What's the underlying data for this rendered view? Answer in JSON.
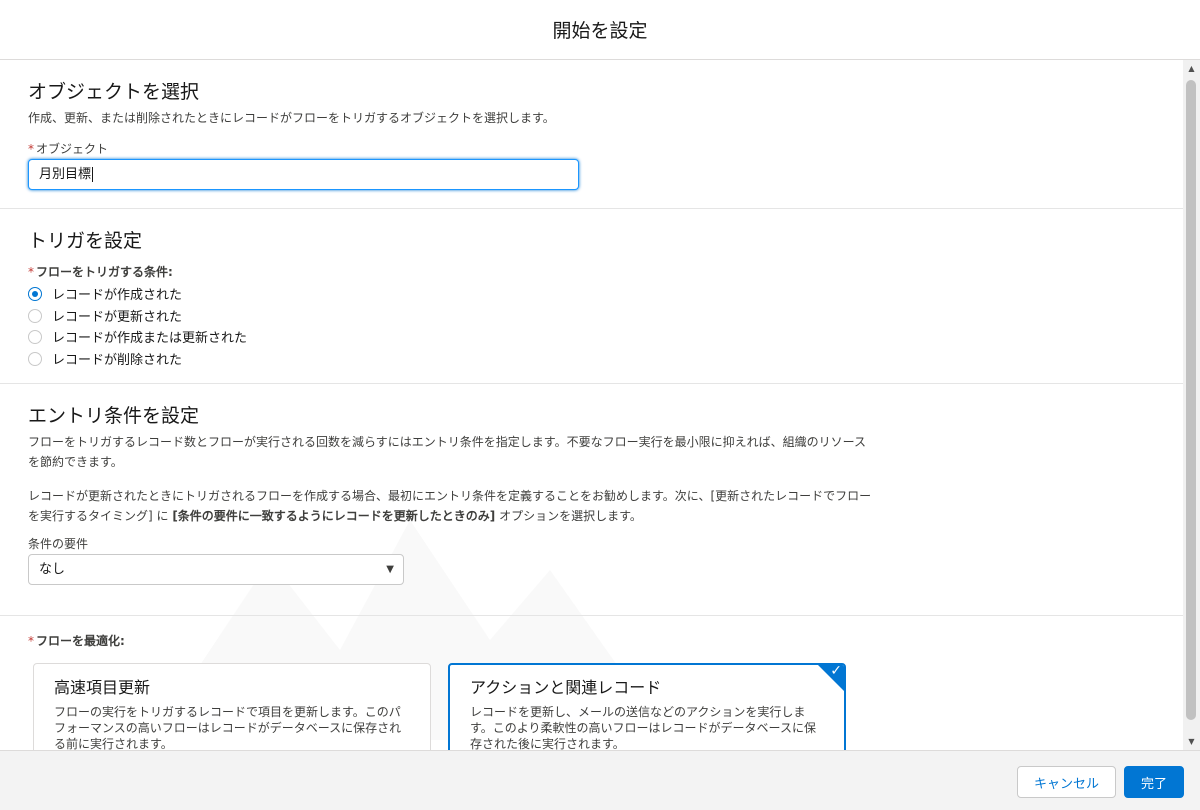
{
  "modal": {
    "title": "開始を設定"
  },
  "object_section": {
    "heading": "オブジェクトを選択",
    "description": "作成、更新、または削除されたときにレコードがフローをトリガするオブジェクトを選択します。",
    "field_required": "*",
    "field_label": "オブジェクト",
    "field_value": "月別目標"
  },
  "trigger_section": {
    "heading": "トリガを設定",
    "field_required": "*",
    "field_label": "フローをトリガする条件:",
    "options": [
      {
        "label": "レコードが作成された",
        "checked": true
      },
      {
        "label": "レコードが更新された",
        "checked": false
      },
      {
        "label": "レコードが作成または更新された",
        "checked": false
      },
      {
        "label": "レコードが削除された",
        "checked": false
      }
    ]
  },
  "entry_section": {
    "heading": "エントリ条件を設定",
    "description_1_line1": "フローをトリガするレコード数とフローが実行される回数を減らすにはエントリ条件を指定します。不要なフロー実行を最小限に抑えれば、組織のリソース",
    "description_1_line2": "を節約できます。",
    "description_2_line1": "レコードが更新されたときにトリガされるフローを作成する場合、最初にエントリ条件を定義することをお勧めします。次に、[更新されたレコードでフロー",
    "description_2_line2_a": "を実行するタイミング] に ",
    "description_2_line2_bold": "[条件の要件に一致するようにレコードを更新したときのみ]",
    "description_2_line2_b": " オプションを選択します。",
    "condition_label": "条件の要件",
    "condition_value": "なし"
  },
  "optimize_section": {
    "field_required": "*",
    "field_label": "フローを最適化:",
    "cards": [
      {
        "title": "高速項目更新",
        "description": "フローの実行をトリガするレコードで項目を更新します。このパフォーマンスの高いフローはレコードがデータベースに保存される前に実行されます。",
        "selected": false
      },
      {
        "title": "アクションと関連レコード",
        "description": "レコードを更新し、メールの送信などのアクションを実行します。このより柔軟性の高いフローはレコードがデータベースに保存された後に実行されます。",
        "selected": true
      }
    ]
  },
  "footer": {
    "cancel_label": "キャンセル",
    "done_label": "完了"
  },
  "colors": {
    "brand": "#0176d3",
    "required": "#c23934",
    "border": "#c9c9c9"
  }
}
